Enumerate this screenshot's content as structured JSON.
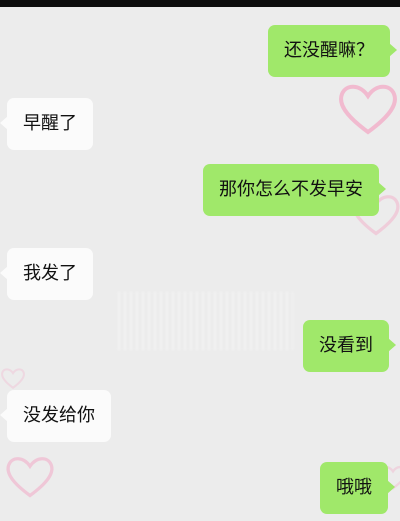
{
  "messages": [
    {
      "side": "sent",
      "text": "还没醒嘛？"
    },
    {
      "side": "received",
      "text": "早醒了"
    },
    {
      "side": "sent",
      "text": "那你怎么不发早安"
    },
    {
      "side": "received",
      "text": "我发了"
    },
    {
      "side": "sent",
      "text": "没看到"
    },
    {
      "side": "received",
      "text": "没发给你"
    },
    {
      "side": "sent",
      "text": "哦哦"
    }
  ],
  "decorations": {
    "heart_color": "#f3a9c6"
  },
  "colors": {
    "sent_bubble": "#a0e86a",
    "received_bubble": "#fbfbfb",
    "background": "#ececec"
  }
}
